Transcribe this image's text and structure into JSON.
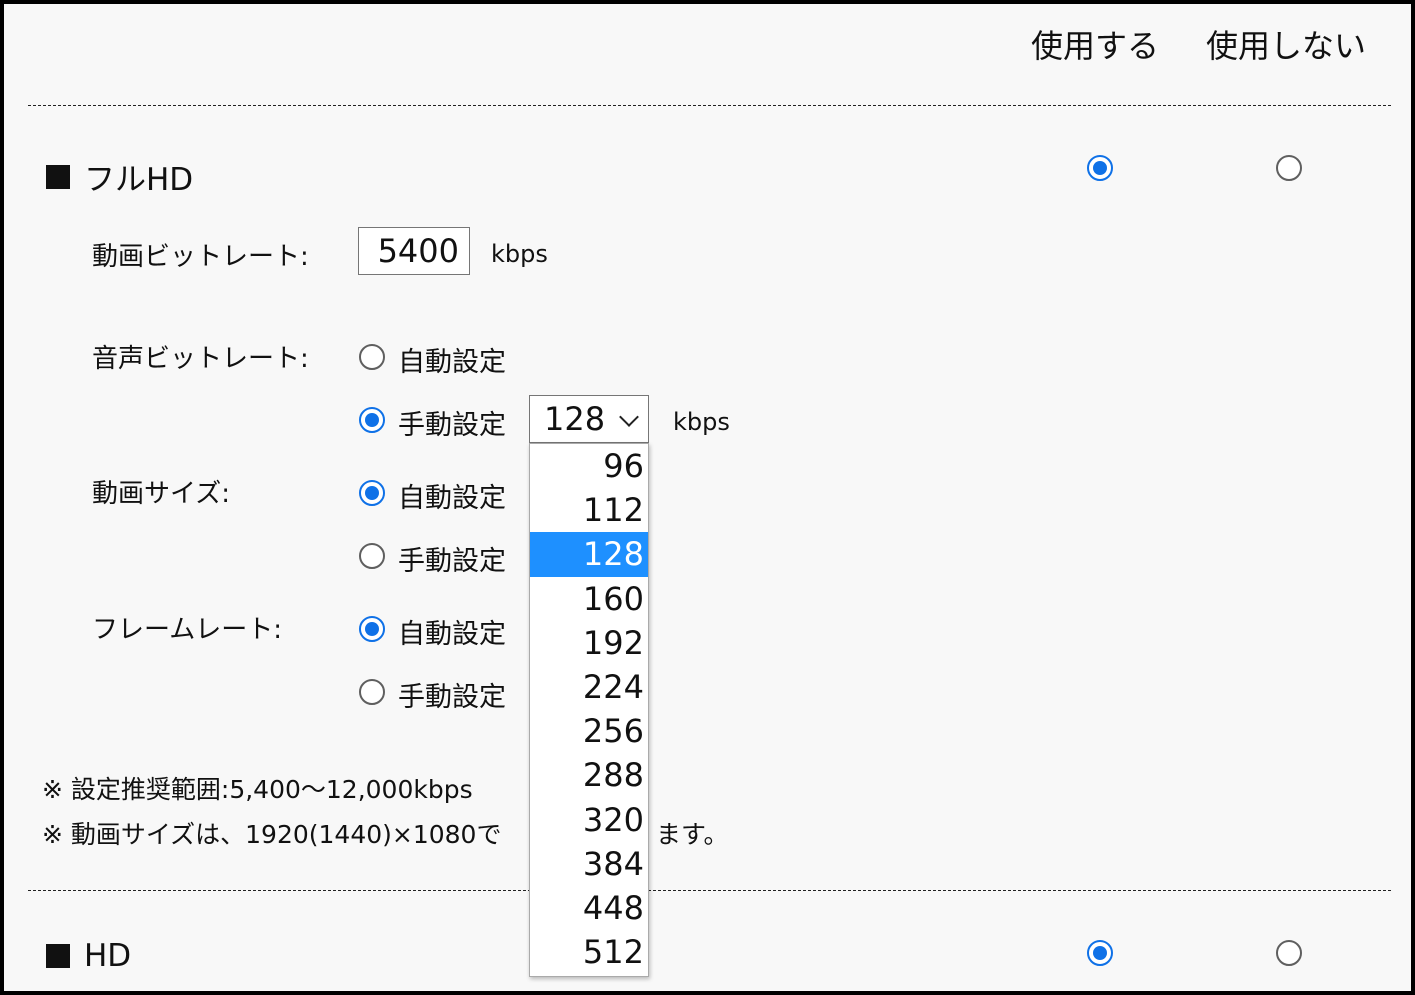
{
  "header": {
    "use_label": "使用する",
    "not_use_label": "使用しない"
  },
  "sections": [
    {
      "title": "フルHD",
      "use_selected": true
    },
    {
      "title": "HD",
      "use_selected": true
    }
  ],
  "video_bitrate": {
    "label": "動画ビットレート:",
    "value": "5400",
    "unit": "kbps"
  },
  "audio_bitrate": {
    "label": "音声ビットレート:",
    "auto_label": "自動設定",
    "manual_label": "手動設定",
    "selected": "manual",
    "select_value": "128",
    "unit": "kbps",
    "options": [
      "96",
      "112",
      "128",
      "160",
      "192",
      "224",
      "256",
      "288",
      "320",
      "384",
      "448",
      "512"
    ],
    "highlighted": "128"
  },
  "video_size": {
    "label": "動画サイズ:",
    "auto_label": "自動設定",
    "manual_label": "手動設定",
    "selected": "auto"
  },
  "frame_rate": {
    "label": "フレームレート:",
    "auto_label": "自動設定",
    "manual_label": "手動設定",
    "selected": "auto"
  },
  "notes": {
    "note1": "※ 設定推奨範囲:5,400〜12,000kbps",
    "note2_start": "※ 動画サイズは、1920(1440)×1080で",
    "note2_end": "ます。"
  },
  "colors": {
    "accent": "#0f71e7",
    "highlight": "#1e90ff"
  }
}
